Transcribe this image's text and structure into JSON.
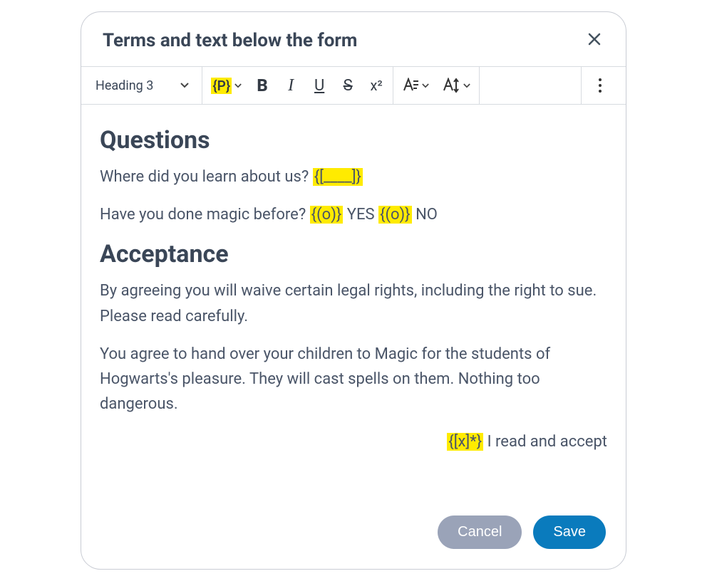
{
  "header": {
    "title": "Terms and text below the form"
  },
  "toolbar": {
    "heading_label": "Heading 3",
    "placeholder_token": "{P}",
    "bold": "B",
    "italic": "I",
    "underline": "U",
    "strike": "S",
    "superscript": "x²"
  },
  "content": {
    "h1": "Questions",
    "q1_text": "Where did you learn about us? ",
    "q1_token": "{[____]}",
    "q2_text": "Have you done magic before? ",
    "q2_token_a": "{(o)}",
    "q2_opt_a": " YES ",
    "q2_token_b": "{(o)}",
    "q2_opt_b": " NO",
    "h2": "Acceptance",
    "p1": "By agreeing you will waive certain legal rights, including the right to sue. Please read carefully.",
    "p2": "You agree to hand over your children to Magic for the students of Hogwarts's pleasure. They will cast spells on them. Nothing too dangerous.",
    "accept_token": "{[x]*}",
    "accept_text": " I read and accept"
  },
  "footer": {
    "cancel": "Cancel",
    "save": "Save"
  }
}
